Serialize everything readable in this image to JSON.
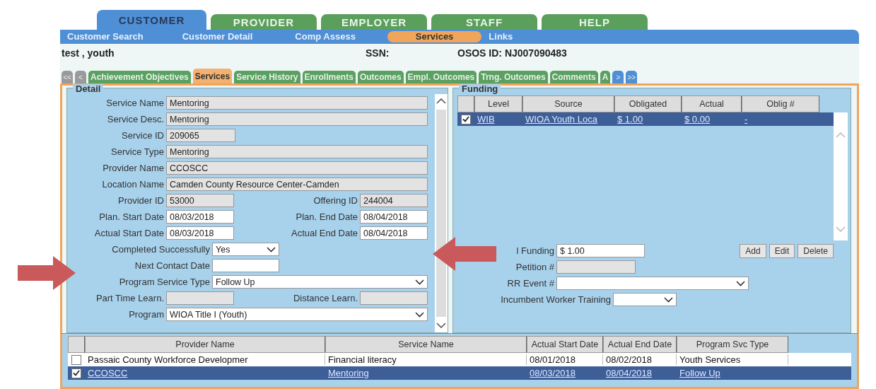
{
  "main_tabs": [
    {
      "label": "CUSTOMER",
      "selected": true
    },
    {
      "label": "PROVIDER",
      "selected": false
    },
    {
      "label": "EMPLOYER",
      "selected": false
    },
    {
      "label": "STAFF",
      "selected": false
    },
    {
      "label": "HELP",
      "selected": false
    }
  ],
  "sub_nav": [
    {
      "label": "Customer Search",
      "selected": false
    },
    {
      "label": "Customer Detail",
      "selected": false
    },
    {
      "label": "Comp Assess",
      "selected": false
    },
    {
      "label": "Services",
      "selected": true
    },
    {
      "label": "Links",
      "selected": false
    }
  ],
  "customer": {
    "name": "test , youth",
    "ssn_label": "SSN:",
    "osos_id": "OSOS ID: NJ007090483"
  },
  "section_tabs": {
    "nav_left": [
      "<<",
      "<"
    ],
    "nav_right": [
      ">",
      ">>"
    ],
    "items": [
      {
        "label": "Achievement Objectives",
        "selected": false
      },
      {
        "label": "Services",
        "selected": true
      },
      {
        "label": "Service History",
        "selected": false
      },
      {
        "label": "Enrollments",
        "selected": false
      },
      {
        "label": "Outcomes",
        "selected": false
      },
      {
        "label": "Empl. Outcomes",
        "selected": false
      },
      {
        "label": "Trng. Outcomes",
        "selected": false
      },
      {
        "label": "Comments",
        "selected": false
      },
      {
        "label": "A",
        "selected": false
      }
    ]
  },
  "detail": {
    "title": "Detail",
    "rows": [
      {
        "kind": "wide",
        "fields": [
          {
            "label": "Service Name",
            "value": "Mentoring",
            "kind": "text",
            "disabled": true
          }
        ]
      },
      {
        "kind": "wide",
        "fields": [
          {
            "label": "Service Desc.",
            "value": "Mentoring",
            "kind": "text",
            "disabled": true
          }
        ]
      },
      {
        "kind": "short",
        "fields": [
          {
            "label": "Service ID",
            "value": "209065",
            "kind": "text",
            "disabled": true
          }
        ]
      },
      {
        "kind": "wide",
        "fields": [
          {
            "label": "Service Type",
            "value": "Mentoring",
            "kind": "text",
            "disabled": true
          }
        ]
      },
      {
        "kind": "wide",
        "fields": [
          {
            "label": "Provider Name",
            "value": "CCOSCC",
            "kind": "text",
            "disabled": true
          }
        ]
      },
      {
        "kind": "wide",
        "fields": [
          {
            "label": "Location Name",
            "value": "Camden County Resource Center-Camden",
            "kind": "text",
            "disabled": true
          }
        ]
      },
      {
        "kind": "pair",
        "fields": [
          {
            "label": "Provider ID",
            "value": "53000",
            "kind": "text",
            "disabled": true
          },
          {
            "label": "Offering ID",
            "value": "244004",
            "kind": "text",
            "disabled": true
          }
        ]
      },
      {
        "kind": "pair",
        "fields": [
          {
            "label": "Plan. Start Date",
            "value": "08/03/2018",
            "kind": "text",
            "disabled": false
          },
          {
            "label": "Plan. End Date",
            "value": "08/04/2018",
            "kind": "text",
            "disabled": false
          }
        ]
      },
      {
        "kind": "pair",
        "fields": [
          {
            "label": "Actual Start Date",
            "value": "08/03/2018",
            "kind": "text",
            "disabled": false
          },
          {
            "label": "Actual End Date",
            "value": "08/04/2018",
            "kind": "text",
            "disabled": false
          }
        ]
      },
      {
        "kind": "long_short",
        "fields": [
          {
            "label": "Completed Successfully",
            "value": "Yes",
            "kind": "select",
            "disabled": false
          }
        ]
      },
      {
        "kind": "long_short",
        "fields": [
          {
            "label": "Next Contact Date",
            "kind": "text",
            "disabled": false
          }
        ]
      },
      {
        "kind": "long_wide",
        "fields": [
          {
            "label": "Program Service Type",
            "value": "Follow Up",
            "kind": "select",
            "disabled": false
          }
        ]
      },
      {
        "kind": "pair",
        "fields": [
          {
            "label": "Part Time Learn.",
            "kind": "text",
            "disabled": true
          },
          {
            "label": "Distance Learn.",
            "kind": "text",
            "disabled": true
          }
        ]
      },
      {
        "kind": "wide",
        "fields": [
          {
            "label": "Program",
            "value": "WIOA Title I (Youth)",
            "kind": "select",
            "disabled": false
          }
        ]
      }
    ]
  },
  "funding": {
    "title": "Funding",
    "columns": [
      "Level",
      "Source",
      "Obligated",
      "Actual",
      "Oblig #"
    ],
    "rows": [
      {
        "checked": true,
        "selected": true,
        "cells": [
          "WIB",
          "WIOA Youth Loca",
          "$ 1.00",
          "$ 0.00",
          "-"
        ]
      }
    ],
    "total_label": "l Funding",
    "total_value": "$ 1.00",
    "buttons": [
      "Add",
      "Edit",
      "Delete"
    ],
    "petition_label": "Petition #",
    "rr_label": "RR Event #",
    "incumbent_label": "Incumbent Worker Training"
  },
  "services_table": {
    "columns": [
      "Provider Name",
      "Service Name",
      "Actual Start Date",
      "Actual End Date",
      "Program Svc Type"
    ],
    "rows": [
      {
        "checked": false,
        "selected": false,
        "cells": [
          "Passaic County Workforce Developmer",
          "Financial literacy",
          "08/01/2018",
          "08/02/2018",
          "Youth Services"
        ]
      },
      {
        "checked": true,
        "selected": true,
        "cells": [
          "CCOSCC",
          "Mentoring",
          "08/03/2018",
          "08/04/2018",
          "Follow Up"
        ]
      }
    ]
  }
}
